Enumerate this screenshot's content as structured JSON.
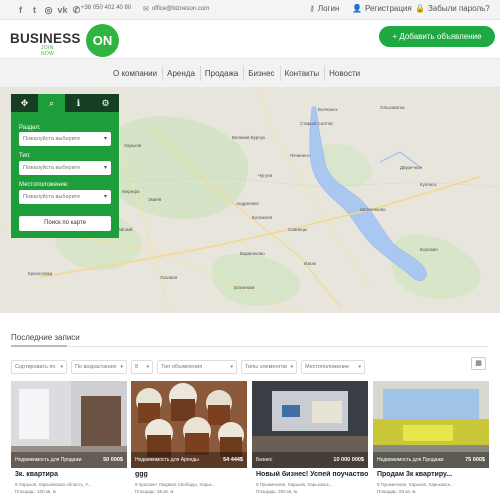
{
  "topbar": {
    "social": [
      {
        "icon": "facebook-icon",
        "glyph": "f"
      },
      {
        "icon": "twitter-icon",
        "glyph": "t"
      },
      {
        "icon": "instagram-icon",
        "glyph": "◎"
      },
      {
        "icon": "vk-icon",
        "glyph": "vk"
      },
      {
        "icon": "phone-icon",
        "glyph": "✆"
      }
    ],
    "phone": "+38 050 402 40 80",
    "email": "office@bizneson.com",
    "login": "Логин",
    "register": "Регистрация",
    "forgot": "Забыли пароль?"
  },
  "header": {
    "logo_text": "BUSINESS",
    "logo_sub": "JOIN NOW",
    "logo_badge": "ON",
    "add_button": "+ Добавить объявление",
    "brand_color": "#2fb441"
  },
  "nav": {
    "items": [
      "О компании",
      "Аренда",
      "Продажа",
      "Бизнес",
      "Контакты",
      "Новости"
    ]
  },
  "map": {
    "tools": [
      {
        "icon": "move-icon",
        "glyph": "✥"
      },
      {
        "icon": "search-icon",
        "glyph": "⌕"
      },
      {
        "icon": "info-icon",
        "glyph": "ℹ"
      },
      {
        "icon": "share-icon",
        "glyph": "⚙"
      }
    ],
    "region_label": "Раздел:",
    "region_placeholder": "Пожалуйста выберите",
    "type_label": "Тип:",
    "type_placeholder": "Пожалуйста выберите",
    "location_label": "Местоположение:",
    "location_placeholder": "Пожалуйста выберите",
    "search_button": "Поиск по карте",
    "places": [
      "Великий Бурлук",
      "Ольховатка",
      "Двуречная",
      "Купянск",
      "Волчанск",
      "Старый Салтов",
      "Печенеги",
      "Чугуев",
      "Шевченково",
      "Андреевка",
      "Балаклея",
      "Савинцы",
      "Изюм",
      "Боровая",
      "Барвенково",
      "Лозовая",
      "Близнюки",
      "Змиёв",
      "Первомайский",
      "Мерефа",
      "Харьков",
      "Красноград"
    ]
  },
  "listings": {
    "title": "Последние записи",
    "filters": [
      "Сортировать по",
      "По возрастанию",
      "8",
      "Тип объявления",
      "Типы элементов",
      "Местоположение"
    ],
    "cards": [
      {
        "category": "Недвижимость для Продажи",
        "price": "50 000$",
        "title": "3к. квартира",
        "address": "9 Харьков, Харьковская область, У...",
        "area": "Площадь: 100 кв. м."
      },
      {
        "category": "Недвижимость для Аренды",
        "price": "54 444$",
        "title": "ggg",
        "address": "9 проспект Людвига Свободы, Харьк...",
        "area": "Площадь: 56 кв. м."
      },
      {
        "category": "Бизнес",
        "price": "10 000 000$",
        "title": "Новый бизнес! Успей поучаствоват...",
        "address": "9 Пушкинская, Харьков, Харьковск...",
        "area": "Площадь: 200 кв. м."
      },
      {
        "category": "Недвижимость для Продажи",
        "price": "75 000$",
        "title": "Продам 3к квартиру...",
        "address": "9 Пушкинская, Харьков, Харьковск...",
        "area": "Площадь: 83 кв. м."
      }
    ]
  }
}
